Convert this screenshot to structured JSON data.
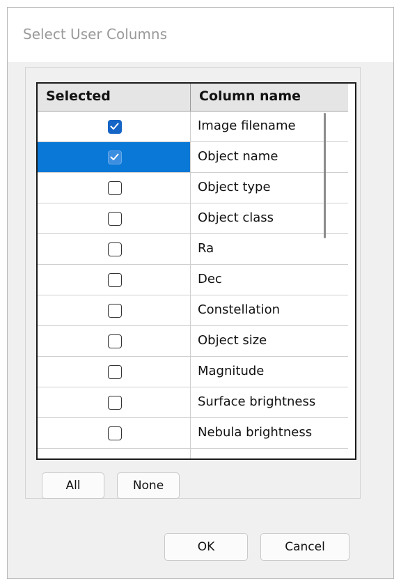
{
  "window": {
    "title": "Select User Columns"
  },
  "grid": {
    "headers": {
      "selected": "Selected",
      "column_name": "Column name"
    },
    "rows": [
      {
        "name": "Image filename",
        "checked": true,
        "selected": false
      },
      {
        "name": "Object name",
        "checked": true,
        "selected": true
      },
      {
        "name": "Object type",
        "checked": false,
        "selected": false
      },
      {
        "name": "Object class",
        "checked": false,
        "selected": false
      },
      {
        "name": "Ra",
        "checked": false,
        "selected": false
      },
      {
        "name": "Dec",
        "checked": false,
        "selected": false
      },
      {
        "name": "Constellation",
        "checked": false,
        "selected": false
      },
      {
        "name": "Object size",
        "checked": false,
        "selected": false
      },
      {
        "name": "Magnitude",
        "checked": false,
        "selected": false
      },
      {
        "name": "Surface brightness",
        "checked": false,
        "selected": false
      },
      {
        "name": "Nebula brightness",
        "checked": false,
        "selected": false
      }
    ]
  },
  "buttons": {
    "all": "All",
    "none": "None",
    "ok": "OK",
    "cancel": "Cancel"
  },
  "colors": {
    "selection": "#0a78d7",
    "checkbox_checked": "#1565c6"
  }
}
